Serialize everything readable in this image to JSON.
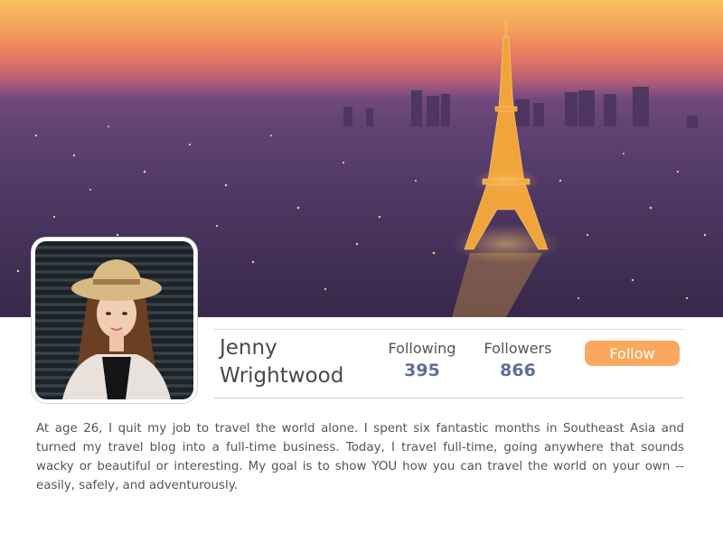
{
  "cover": {
    "image": "paris-eiffel-tower-dusk"
  },
  "profile": {
    "name": "Jenny Wrightwood",
    "avatar": "profile-photo-woman-straw-hat"
  },
  "stats": {
    "following_label": "Following",
    "following_value": "395",
    "followers_label": "Followers",
    "followers_value": "866"
  },
  "actions": {
    "follow_label": "Follow",
    "follow_color": "#f9a85e"
  },
  "bio": "At age 26, I quit my job to travel the world alone. I spent six fantastic months in Southeast Asia and turned my travel blog into a full-time business. Today, I travel full-time, going anywhere that sounds wacky or beautiful or interesting. My goal is to show YOU how you can travel the world on your own -- easily, safely, and adventurously.",
  "colors": {
    "accent": "#f9a85e",
    "stat_value": "#5f6e98",
    "text": "#555555"
  }
}
